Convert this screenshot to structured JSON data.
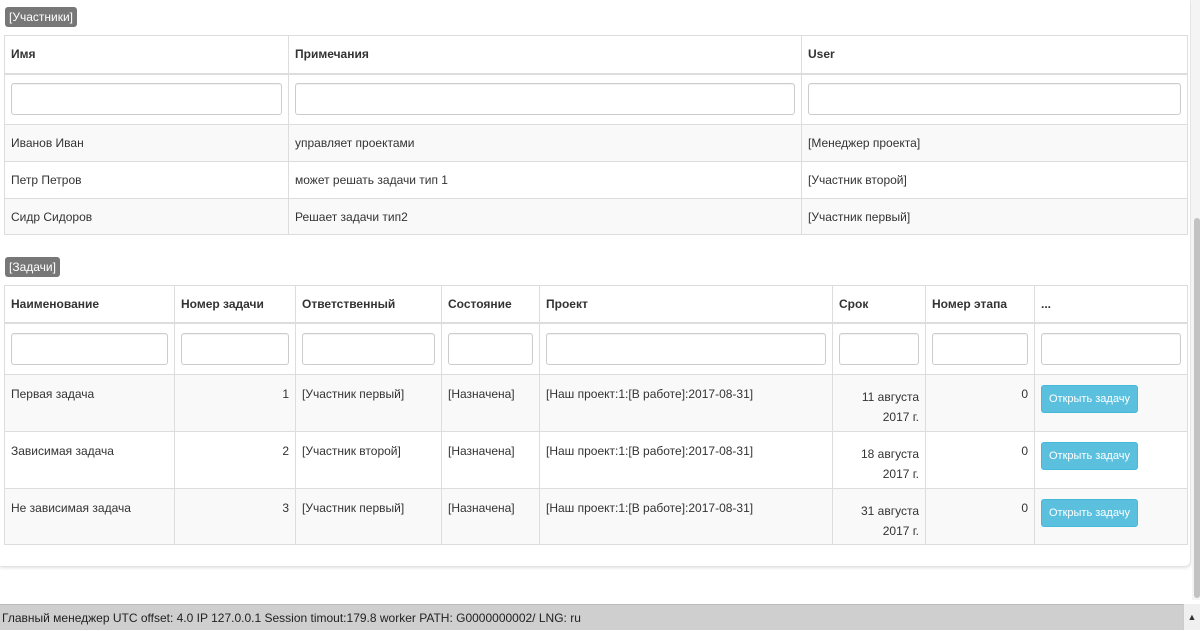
{
  "participants": {
    "section_label": "[Участники]",
    "headers": [
      "Имя",
      "Примечания",
      "User"
    ],
    "rows": [
      {
        "name": "Иванов Иван",
        "notes": "управляет проектами",
        "user": "[Менеджер проекта]"
      },
      {
        "name": "Петр Петров",
        "notes": "может решать задачи тип 1",
        "user": "[Участник второй]"
      },
      {
        "name": "Сидр Сидоров",
        "notes": "Решает задачи тип2",
        "user": "[Участник первый]"
      }
    ]
  },
  "tasks": {
    "section_label": "[Задачи]",
    "headers": [
      "Наименование",
      "Номер задачи",
      "Ответственный",
      "Состояние",
      "Проект",
      "Срок",
      "Номер этапа",
      "..."
    ],
    "rows": [
      {
        "name": "Первая задача",
        "number": "1",
        "responsible": "[Участник первый]",
        "state": "[Назначена]",
        "project": "[Наш проект:1:[В работе]:2017-08-31]",
        "deadline": "11 августа 2017 г.",
        "stage": "0",
        "action": "Открыть задачу"
      },
      {
        "name": "Зависимая задача",
        "number": "2",
        "responsible": "[Участник второй]",
        "state": "[Назначена]",
        "project": "[Наш проект:1:[В работе]:2017-08-31]",
        "deadline": "18 августа 2017 г.",
        "stage": "0",
        "action": "Открыть задачу"
      },
      {
        "name": "Не зависимая задача",
        "number": "3",
        "responsible": "[Участник первый]",
        "state": "[Назначена]",
        "project": "[Наш проект:1:[В работе]:2017-08-31]",
        "deadline": "31 августа 2017 г.",
        "stage": "0",
        "action": "Открыть задачу"
      }
    ]
  },
  "status_bar": {
    "text": "Главный менеджер UTC offset: 4.0 IP 127.0.0.1 Session timout:179.8 worker PATH: G0000000002/ LNG: ru",
    "scroll_up_glyph": "▲"
  }
}
